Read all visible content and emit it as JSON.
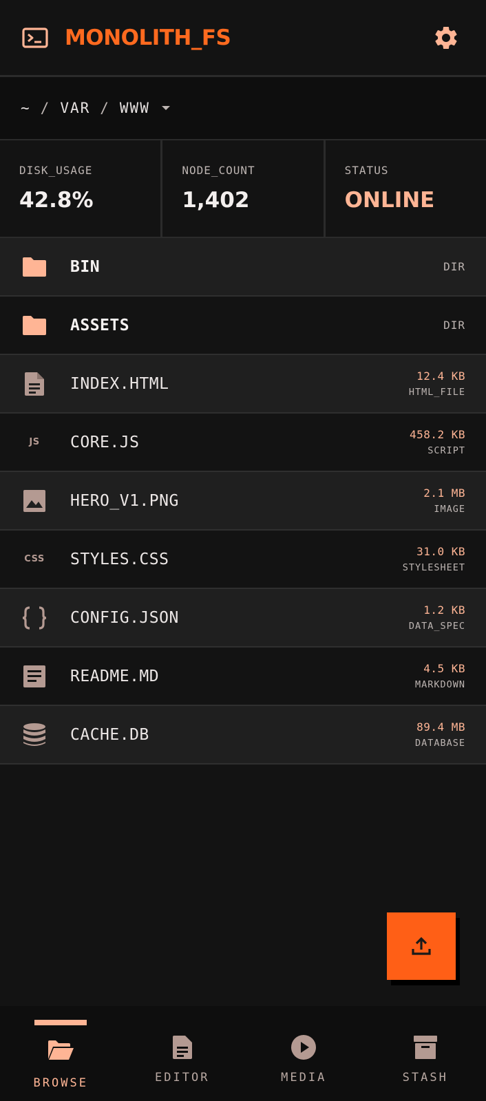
{
  "app": {
    "title": "MONOLITH_FS"
  },
  "breadcrumb": {
    "parts": [
      "~",
      "VAR",
      "WWW"
    ],
    "separator": "/"
  },
  "stats": [
    {
      "label": "DISK_USAGE",
      "value": "42.8%"
    },
    {
      "label": "NODE_COUNT",
      "value": "1,402"
    },
    {
      "label": "STATUS",
      "value": "ONLINE"
    }
  ],
  "files": [
    {
      "name": "BIN",
      "size": "",
      "kind": "DIR",
      "icon": "folder-icon"
    },
    {
      "name": "ASSETS",
      "size": "",
      "kind": "DIR",
      "icon": "folder-icon"
    },
    {
      "name": "INDEX.HTML",
      "size": "12.4 KB",
      "kind": "HTML_FILE",
      "icon": "file-icon"
    },
    {
      "name": "CORE.JS",
      "size": "458.2 KB",
      "kind": "SCRIPT",
      "icon": "javascript-icon",
      "icon_text": "JS"
    },
    {
      "name": "HERO_V1.PNG",
      "size": "2.1 MB",
      "kind": "IMAGE",
      "icon": "image-icon"
    },
    {
      "name": "STYLES.CSS",
      "size": "31.0 KB",
      "kind": "STYLESHEET",
      "icon": "css-icon",
      "icon_text": "CSS"
    },
    {
      "name": "CONFIG.JSON",
      "size": "1.2 KB",
      "kind": "DATA_SPEC",
      "icon": "braces-icon"
    },
    {
      "name": "README.MD",
      "size": "4.5 KB",
      "kind": "MARKDOWN",
      "icon": "article-icon"
    },
    {
      "name": "CACHE.DB",
      "size": "89.4 MB",
      "kind": "DATABASE",
      "icon": "database-icon"
    }
  ],
  "nav": [
    {
      "label": "BROWSE",
      "icon": "folder-open-icon",
      "active": true
    },
    {
      "label": "EDITOR",
      "icon": "document-icon",
      "active": false
    },
    {
      "label": "MEDIA",
      "icon": "play-circle-icon",
      "active": false
    },
    {
      "label": "STASH",
      "icon": "archive-icon",
      "active": false
    }
  ],
  "colors": {
    "accent": "#ff6a1f",
    "fab": "#ff5f16",
    "peach": "#ffb595",
    "icon_muted": "#b49a92",
    "background": "#131313"
  }
}
